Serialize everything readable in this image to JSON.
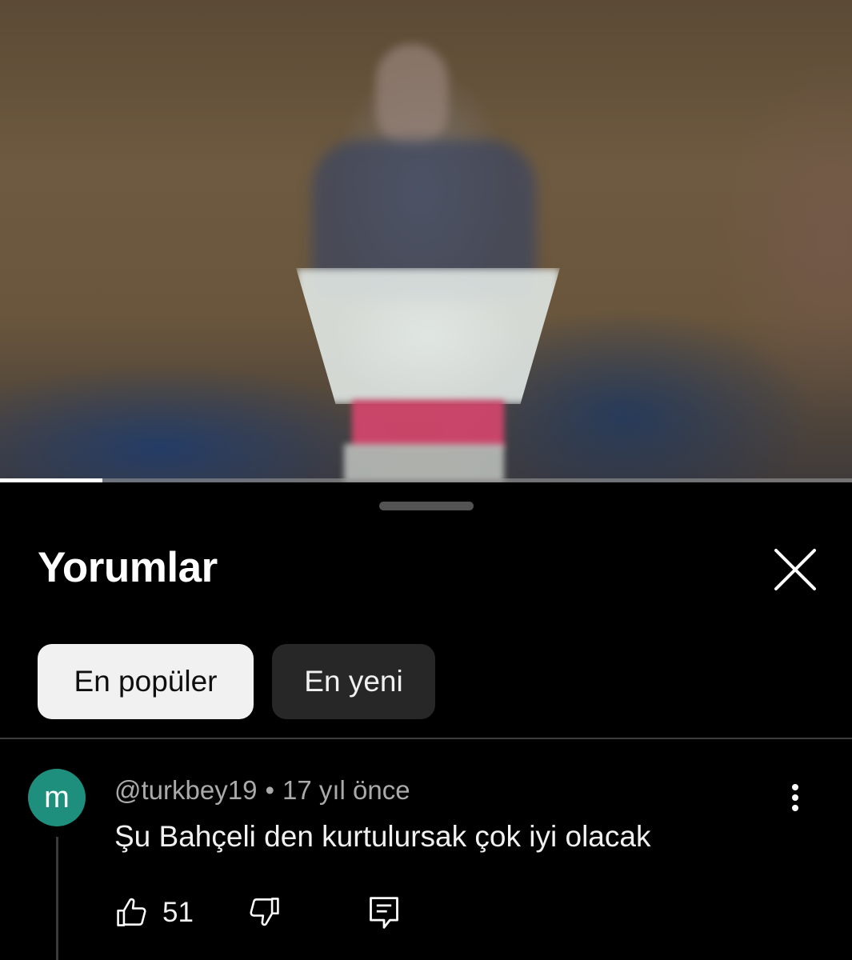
{
  "video": {
    "progress_fraction": 0.12
  },
  "comments_panel": {
    "title": "Yorumlar",
    "close_icon": "close-icon",
    "sort_chips": [
      {
        "label": "En popüler",
        "selected": true
      },
      {
        "label": "En yeni",
        "selected": false
      }
    ]
  },
  "comment": {
    "avatar_letter": "m",
    "avatar_color": "#1e8f7d",
    "author": "@turkbey19",
    "separator": "•",
    "time": "17 yıl önce",
    "text": "Şu Bahçeli den kurtulursak çok iyi olacak",
    "likes": "51",
    "icons": {
      "more": "more-vertical-icon",
      "like": "thumbs-up-icon",
      "dislike": "thumbs-down-icon",
      "reply": "reply-comment-icon"
    }
  }
}
